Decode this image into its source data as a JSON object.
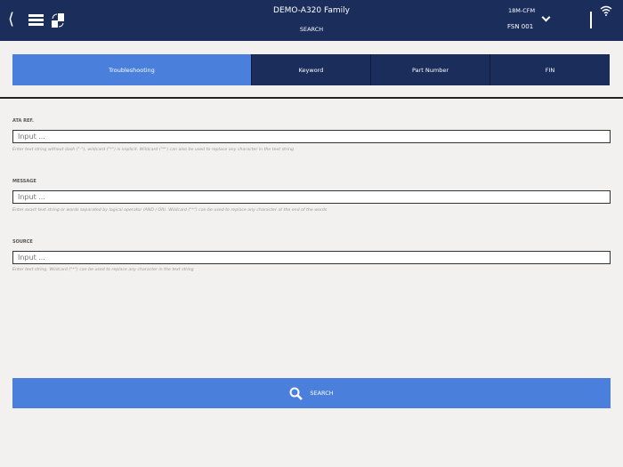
{
  "header": {
    "title": "DEMO-A320 Family",
    "subtitle": "SEARCH",
    "aircraft": "18M-CFM",
    "fsn": "FSN 001"
  },
  "tabs": [
    {
      "label": "Troubleshooting",
      "active": true
    },
    {
      "label": "Keyword"
    },
    {
      "label": "Part Number"
    },
    {
      "label": "FIN"
    }
  ],
  "fields": [
    {
      "label": "ATA REF.",
      "placeholder": "Input ...",
      "hint": "Enter text string without dash (\"-\"), wildcard (\"*\") is implicit. Wildcard (\"*\") can also be used to replace any character in the text string"
    },
    {
      "label": "MESSAGE",
      "placeholder": "Input ...",
      "hint": "Enter exact text string or words separated by logical operator (AND / OR). Wildcard (\"*\") can be used to replace any character at the end of the words"
    },
    {
      "label": "SOURCE",
      "placeholder": "Input ...",
      "hint": "Enter text string. Wildcard (\"*\") can be used to replace any character in the text string"
    }
  ],
  "search_label": "SEARCH"
}
